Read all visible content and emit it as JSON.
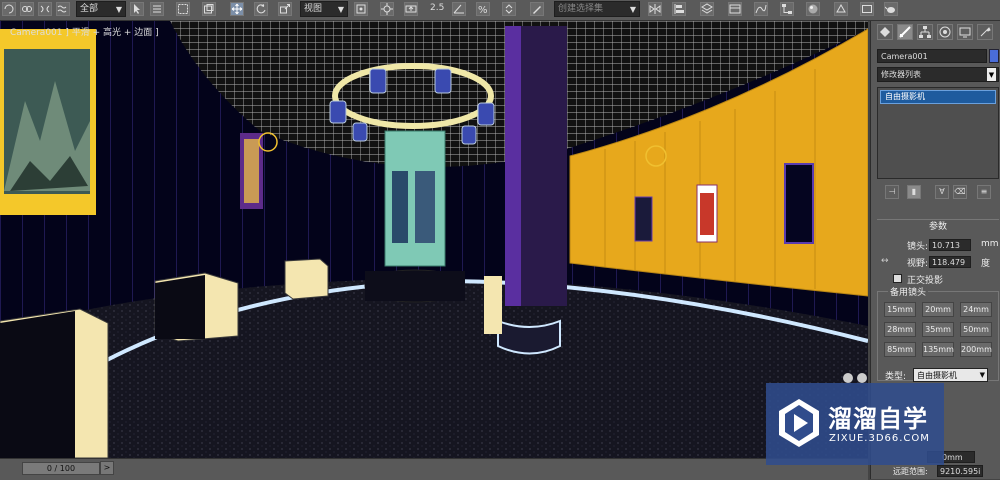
{
  "toolbar": {
    "selection_filter": "全部",
    "viewport_type": "视图",
    "snap_value": "2.5",
    "named_selection_placeholder": "创建选择集"
  },
  "viewport": {
    "label": "Camera001 ] 平滑 + 高光 + 边面 ]"
  },
  "timeline": {
    "frame_readout": "0 / 100",
    "next_arrow": ">"
  },
  "panel": {
    "object_name": "Camera001",
    "object_color": "#4a6dd9",
    "modifier_list": "修改器列表",
    "stack_item": "自由摄影机",
    "params_title": "参数",
    "lens_label": "镜头:",
    "lens_value": "10.713",
    "lens_unit": "mm",
    "fov_label": "视野:",
    "fov_value": "118.479",
    "fov_unit": "度",
    "ortho_label": "正交投影",
    "stock_lenses_title": "备用镜头",
    "stock_lenses": [
      "15mm",
      "20mm",
      "24mm",
      "28mm",
      "35mm",
      "50mm",
      "85mm",
      "135mm",
      "200mm"
    ],
    "type_label": "类型:",
    "type_value": "自由摄影机",
    "env_range_value": "0mm",
    "far_range_label": "远距范围:",
    "far_range_value": "9210.595i"
  },
  "watermark": {
    "title": "溜溜自学",
    "subtitle": "ZIXUE.3D66.COM"
  }
}
